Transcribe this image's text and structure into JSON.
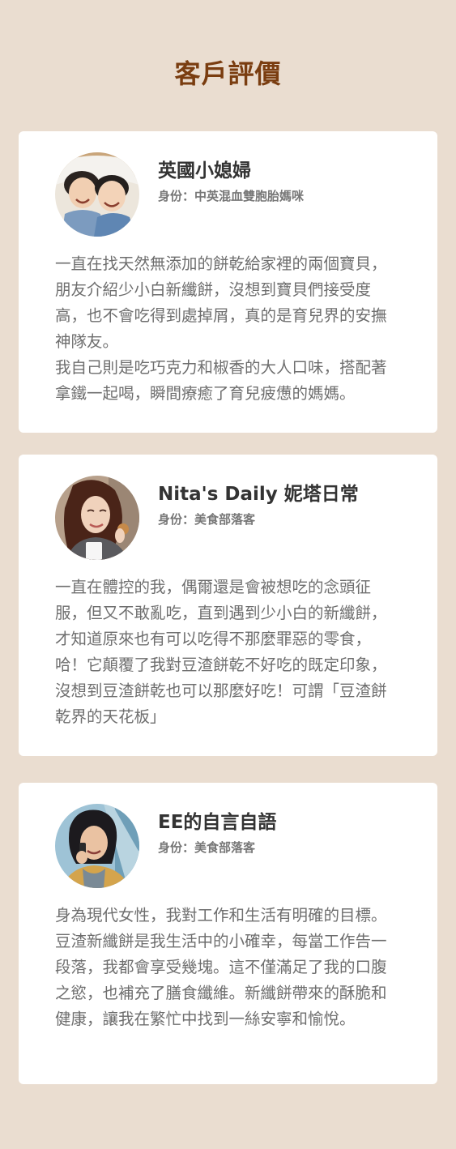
{
  "section": {
    "title": "客戶評價"
  },
  "testimonials": [
    {
      "name": "英國小媳婦",
      "role": "身份：中英混血雙胞胎媽咪",
      "avatar_icon": "twin-children-photo",
      "paragraphs": [
        "一直在找天然無添加的餅乾給家裡的兩個寶貝，朋友介紹少小白新纖餅，沒想到寶貝們接受度高，也不會吃得到處掉屑，真的是育兒界的安撫神隊友。",
        "我自己則是吃巧克力和椒香的大人口味，搭配著拿鐵一起喝，瞬間療癒了育兒疲憊的媽媽。"
      ]
    },
    {
      "name": "Nita's Daily 妮塔日常",
      "role": "身份：美食部落客",
      "avatar_icon": "woman-eating-cookie-photo",
      "paragraphs": [
        "一直在體控的我，偶爾還是會被想吃的念頭征服，但又不敢亂吃，直到遇到少小白的新纖餅，才知道原來也有可以吃得不那麼罪惡的零食，哈！它顛覆了我對豆渣餅乾不好吃的既定印象，沒想到豆渣餅乾也可以那麼好吃！可謂「豆渣餅乾界的天花板」"
      ]
    },
    {
      "name": "EE的自言自語",
      "role": "身份：美食部落客",
      "avatar_icon": "woman-on-phone-photo",
      "paragraphs": [
        "身為現代女性，我對工作和生活有明確的目標。豆渣新纖餅是我生活中的小確幸，每當工作告一段落，我都會享受幾塊。這不僅滿足了我的口腹之慾，也補充了膳食纖維。新纖餅帶來的酥脆和健康，讓我在繁忙中找到一絲安寧和愉悅。"
      ]
    }
  ]
}
